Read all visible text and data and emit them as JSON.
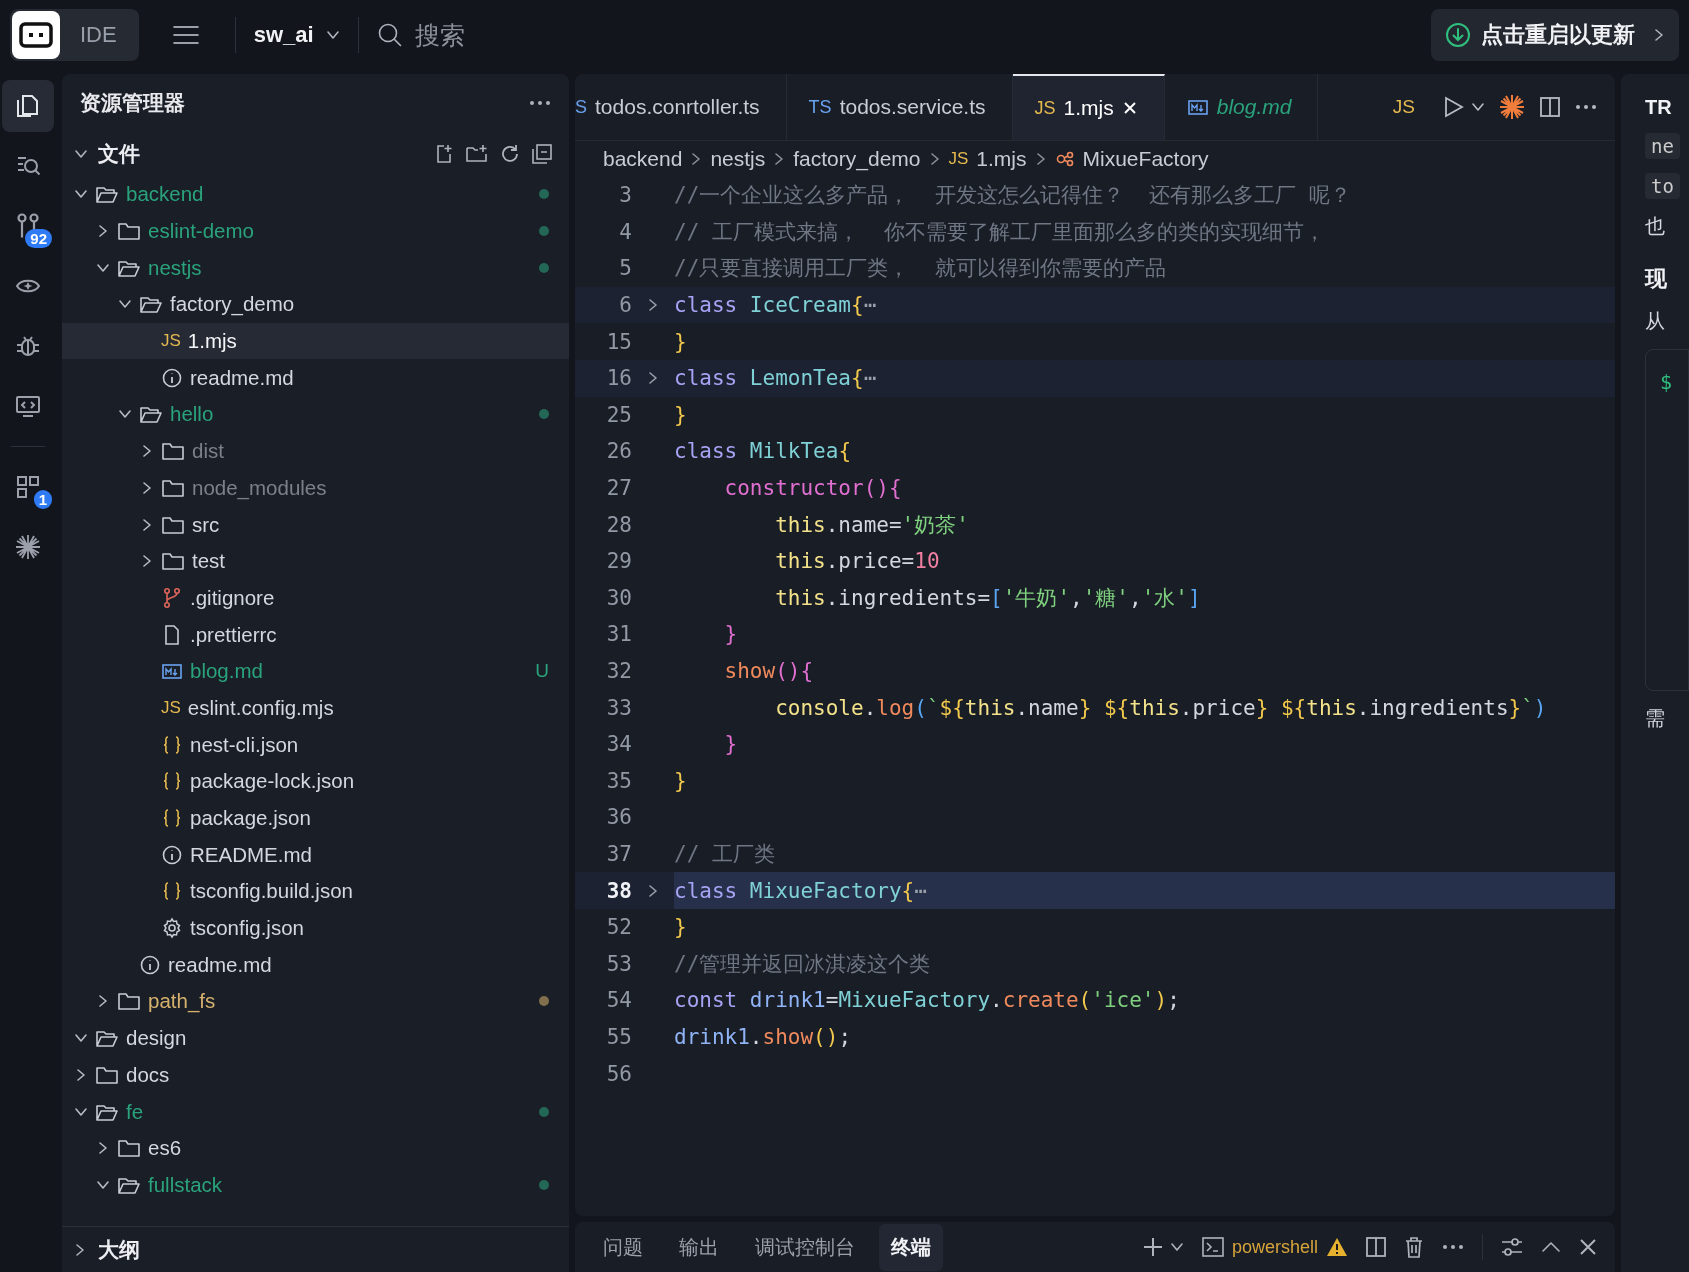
{
  "topbar": {
    "product": "IDE",
    "project": "sw_ai",
    "search": {
      "placeholder": "搜索"
    },
    "update_button": "点击重启以更新"
  },
  "activity_bar": [
    {
      "kind": "files",
      "selected": true
    },
    {
      "kind": "search",
      "selected": false
    },
    {
      "kind": "git",
      "badge": "92",
      "selected": false
    },
    {
      "kind": "eye",
      "selected": false
    },
    {
      "kind": "bug",
      "selected": false
    },
    {
      "kind": "remote",
      "selected": false
    },
    {
      "kind": "extensions",
      "badge": "1",
      "selected": false
    },
    {
      "kind": "sparkle",
      "selected": false
    }
  ],
  "explorer": {
    "title": "资源管理器",
    "section": "文件",
    "tree": [
      {
        "label": "backend",
        "kind": "folder",
        "expanded": true,
        "color": "#2aa37c",
        "dot": true,
        "selected": false,
        "children": [
          {
            "label": "eslint-demo",
            "kind": "folder",
            "expanded": false,
            "color": "#2aa37c",
            "dot": true,
            "selected": false
          },
          {
            "label": "nestjs",
            "kind": "folder",
            "expanded": true,
            "color": "#2aa37c",
            "dot": true,
            "selected": false,
            "children": [
              {
                "label": "factory_demo",
                "kind": "folder",
                "expanded": true,
                "color": "#d4d7de",
                "dot": false,
                "selected": false,
                "children": [
                  {
                    "label": "1.mjs",
                    "kind": "js",
                    "icon": "JS",
                    "color": "#f4f5f7",
                    "selected": true
                  },
                  {
                    "label": "readme.md",
                    "kind": "info",
                    "color": "#d4d7de",
                    "selected": false
                  }
                ]
              },
              {
                "label": "hello",
                "kind": "folder",
                "expanded": true,
                "color": "#2aa37c",
                "dot": true,
                "selected": false,
                "children": [
                  {
                    "label": "dist",
                    "kind": "folder",
                    "expanded": false,
                    "color": "#7b808b",
                    "dot": false,
                    "selected": false
                  },
                  {
                    "label": "node_modules",
                    "kind": "folder",
                    "expanded": false,
                    "color": "#7b808b",
                    "dot": false,
                    "selected": false
                  },
                  {
                    "label": "src",
                    "kind": "folder",
                    "expanded": false,
                    "color": "#d4d7de",
                    "dot": false,
                    "selected": false
                  },
                  {
                    "label": "test",
                    "kind": "folder",
                    "expanded": false,
                    "color": "#d4d7de",
                    "dot": false,
                    "selected": false
                  },
                  {
                    "label": ".gitignore",
                    "kind": "git",
                    "color": "#d4d7de",
                    "selected": false
                  },
                  {
                    "label": ".prettierrc",
                    "kind": "file",
                    "color": "#d4d7de",
                    "selected": false
                  },
                  {
                    "label": "blog.md",
                    "kind": "md",
                    "color": "#2aa37c",
                    "badge": "U",
                    "selected": false
                  },
                  {
                    "label": "eslint.config.mjs",
                    "kind": "js",
                    "icon": "JS",
                    "color": "#d4d7de",
                    "selected": false
                  },
                  {
                    "label": "nest-cli.json",
                    "kind": "json",
                    "color": "#d4d7de",
                    "selected": false
                  },
                  {
                    "label": "package-lock.json",
                    "kind": "json",
                    "color": "#d4d7de",
                    "selected": false
                  },
                  {
                    "label": "package.json",
                    "kind": "json",
                    "color": "#d4d7de",
                    "selected": false
                  },
                  {
                    "label": "README.md",
                    "kind": "info",
                    "color": "#d4d7de",
                    "selected": false
                  },
                  {
                    "label": "tsconfig.build.json",
                    "kind": "json",
                    "color": "#d4d7de",
                    "selected": false
                  },
                  {
                    "label": "tsconfig.json",
                    "kind": "gear",
                    "color": "#d4d7de",
                    "selected": false
                  }
                ]
              },
              {
                "label": "readme.md",
                "kind": "info",
                "color": "#d4d7de",
                "selected": false
              }
            ]
          },
          {
            "label": "path_fs",
            "kind": "folder",
            "expanded": false,
            "color": "#d6b26e",
            "dot": true,
            "selected": false
          }
        ]
      },
      {
        "label": "design",
        "kind": "folder",
        "expanded": true,
        "color": "#d4d7de",
        "dot": false,
        "selected": false
      },
      {
        "label": "docs",
        "kind": "folder",
        "expanded": false,
        "color": "#d4d7de",
        "dot": false,
        "selected": false
      },
      {
        "label": "fe",
        "kind": "folder",
        "expanded": true,
        "color": "#2aa37c",
        "dot": true,
        "selected": false,
        "children": [
          {
            "label": "es6",
            "kind": "folder",
            "expanded": false,
            "color": "#d4d7de",
            "dot": false,
            "selected": false
          },
          {
            "label": "fullstack",
            "kind": "folder",
            "expanded": true,
            "color": "#2aa37c",
            "dot": true,
            "selected": false
          }
        ]
      }
    ],
    "bottom_section": "大纲"
  },
  "editor": {
    "tabs": [
      {
        "kind": "ts",
        "icon": "S",
        "label": "todos.conrtoller.ts",
        "selected": false,
        "preview": false
      },
      {
        "kind": "ts",
        "icon": "TS",
        "label": "todos.service.ts",
        "selected": false,
        "preview": false
      },
      {
        "kind": "js",
        "icon": "JS",
        "label": "1.mjs",
        "selected": true,
        "preview": false
      },
      {
        "kind": "md",
        "label": "blog.md",
        "selected": false,
        "preview": true
      }
    ],
    "toolbar_language": "JS",
    "breadcrumbs": [
      {
        "label": "backend",
        "kind": "folder"
      },
      {
        "label": "nestjs",
        "kind": "folder"
      },
      {
        "label": "factory_demo",
        "kind": "folder"
      },
      {
        "label": "1.mjs",
        "kind": "js",
        "icon": "JS"
      },
      {
        "label": "MixueFactory",
        "kind": "symbol"
      }
    ],
    "lines": [
      {
        "number": "3",
        "folded": false,
        "current": false,
        "tokens": [
          {
            "kind": "cm",
            "t": "//一个企业这么多产品，  开发这怎么记得住？  还有那么多工厂 呢？"
          }
        ]
      },
      {
        "number": "4",
        "folded": false,
        "current": false,
        "tokens": [
          {
            "kind": "cm",
            "t": "// 工厂模式来搞，  你不需要了解工厂里面那么多的类的实现细节，"
          }
        ]
      },
      {
        "number": "5",
        "folded": false,
        "current": false,
        "tokens": [
          {
            "kind": "cm",
            "t": "//只要直接调用工厂类，  就可以得到你需要的产品"
          }
        ]
      },
      {
        "number": "6",
        "folded": true,
        "current": false,
        "tokens": [
          {
            "kind": "kw",
            "t": "class "
          },
          {
            "kind": "cls",
            "t": "IceCream"
          },
          {
            "kind": "brace",
            "t": "{"
          },
          {
            "kind": "fold",
            "t": "⋯"
          }
        ]
      },
      {
        "number": "15",
        "folded": false,
        "current": false,
        "tokens": [
          {
            "kind": "brace",
            "t": "}"
          }
        ]
      },
      {
        "number": "16",
        "folded": true,
        "current": false,
        "tokens": [
          {
            "kind": "kw",
            "t": "class "
          },
          {
            "kind": "cls",
            "t": "LemonTea"
          },
          {
            "kind": "brace",
            "t": "{"
          },
          {
            "kind": "fold",
            "t": "⋯"
          }
        ]
      },
      {
        "number": "25",
        "folded": false,
        "current": false,
        "tokens": [
          {
            "kind": "brace",
            "t": "}"
          }
        ]
      },
      {
        "number": "26",
        "folded": false,
        "current": false,
        "tokens": [
          {
            "kind": "kw",
            "t": "class "
          },
          {
            "kind": "cls",
            "t": "MilkTea"
          },
          {
            "kind": "brace",
            "t": "{"
          }
        ]
      },
      {
        "number": "27",
        "folded": false,
        "current": false,
        "tokens": [
          {
            "kind": "fn2",
            "t": "    constructor"
          },
          {
            "kind": "brace2",
            "t": "(){"
          }
        ]
      },
      {
        "number": "28",
        "folded": false,
        "current": false,
        "tokens": [
          {
            "kind": "this",
            "t": "        this"
          },
          {
            "kind": "punc",
            "t": ".name="
          },
          {
            "kind": "str",
            "t": "'奶茶'"
          }
        ]
      },
      {
        "number": "29",
        "folded": false,
        "current": false,
        "tokens": [
          {
            "kind": "this",
            "t": "        this"
          },
          {
            "kind": "punc",
            "t": ".price="
          },
          {
            "kind": "num",
            "t": "10"
          }
        ]
      },
      {
        "number": "30",
        "folded": false,
        "current": false,
        "tokens": [
          {
            "kind": "this",
            "t": "        this"
          },
          {
            "kind": "punc",
            "t": ".ingredients="
          },
          {
            "kind": "brace3",
            "t": "["
          },
          {
            "kind": "str",
            "t": "'牛奶'"
          },
          {
            "kind": "punc",
            "t": ","
          },
          {
            "kind": "str",
            "t": "'糖'"
          },
          {
            "kind": "punc",
            "t": ","
          },
          {
            "kind": "str",
            "t": "'水'"
          },
          {
            "kind": "brace3",
            "t": "]"
          }
        ]
      },
      {
        "number": "31",
        "folded": false,
        "current": false,
        "tokens": [
          {
            "kind": "brace2",
            "t": "    }"
          }
        ]
      },
      {
        "number": "32",
        "folded": false,
        "current": false,
        "tokens": [
          {
            "kind": "fn",
            "t": "    show"
          },
          {
            "kind": "brace2",
            "t": "(){"
          }
        ]
      },
      {
        "number": "33",
        "folded": false,
        "current": false,
        "tokens": [
          {
            "kind": "this",
            "t": "        console"
          },
          {
            "kind": "punc",
            "t": "."
          },
          {
            "kind": "fn",
            "t": "log"
          },
          {
            "kind": "brace3",
            "t": "("
          },
          {
            "kind": "str",
            "t": "`"
          },
          {
            "kind": "brace",
            "t": "${"
          },
          {
            "kind": "this",
            "t": "this"
          },
          {
            "kind": "punc",
            "t": ".name"
          },
          {
            "kind": "brace",
            "t": "} ${"
          },
          {
            "kind": "this",
            "t": "this"
          },
          {
            "kind": "punc",
            "t": ".price"
          },
          {
            "kind": "brace",
            "t": "} ${"
          },
          {
            "kind": "this",
            "t": "this"
          },
          {
            "kind": "punc",
            "t": ".ingredients"
          },
          {
            "kind": "brace",
            "t": "}"
          },
          {
            "kind": "str",
            "t": "`"
          },
          {
            "kind": "brace3",
            "t": ")"
          }
        ]
      },
      {
        "number": "34",
        "folded": false,
        "current": false,
        "tokens": [
          {
            "kind": "brace2",
            "t": "    }"
          }
        ]
      },
      {
        "number": "35",
        "folded": false,
        "current": false,
        "tokens": [
          {
            "kind": "brace",
            "t": "}"
          }
        ]
      },
      {
        "number": "36",
        "folded": false,
        "current": false
      },
      {
        "number": "37",
        "folded": false,
        "current": false,
        "tokens": [
          {
            "kind": "cm",
            "t": "// 工厂类"
          }
        ]
      },
      {
        "number": "38",
        "folded": true,
        "current": true,
        "tokens": [
          {
            "kind": "kw",
            "t": "class "
          },
          {
            "kind": "cls",
            "t": "MixueFactory"
          },
          {
            "kind": "brace",
            "t": "{"
          },
          {
            "kind": "fold",
            "t": "⋯"
          }
        ]
      },
      {
        "number": "52",
        "folded": false,
        "current": false,
        "tokens": [
          {
            "kind": "brace",
            "t": "}"
          }
        ]
      },
      {
        "number": "53",
        "folded": false,
        "current": false,
        "tokens": [
          {
            "kind": "cm",
            "t": "//管理并返回冰淇凌这个类"
          }
        ]
      },
      {
        "number": "54",
        "folded": false,
        "current": false,
        "tokens": [
          {
            "kind": "kw",
            "t": "const "
          },
          {
            "kind": "var",
            "t": "drink1"
          },
          {
            "kind": "punc",
            "t": "="
          },
          {
            "kind": "cls",
            "t": "MixueFactory"
          },
          {
            "kind": "punc",
            "t": "."
          },
          {
            "kind": "fn",
            "t": "create"
          },
          {
            "kind": "brace",
            "t": "("
          },
          {
            "kind": "str",
            "t": "'ice'"
          },
          {
            "kind": "brace",
            "t": ")"
          },
          {
            "kind": "punc",
            "t": ";"
          }
        ]
      },
      {
        "number": "55",
        "folded": false,
        "current": false,
        "tokens": [
          {
            "kind": "var",
            "t": "drink1"
          },
          {
            "kind": "punc",
            "t": "."
          },
          {
            "kind": "fn",
            "t": "show"
          },
          {
            "kind": "brace",
            "t": "()"
          },
          {
            "kind": "punc",
            "t": ";"
          }
        ]
      },
      {
        "number": "56",
        "folded": false,
        "current": false
      }
    ]
  },
  "panel": {
    "tabs": [
      {
        "label": "问题",
        "selected": false
      },
      {
        "label": "输出",
        "selected": false
      },
      {
        "label": "调试控制台",
        "selected": false
      },
      {
        "label": "终端",
        "selected": true
      }
    ],
    "terminal": "powershell"
  },
  "right_panel": {
    "title": "TR",
    "lines": [
      {
        "kind": "code",
        "text": "ne"
      },
      {
        "kind": "code",
        "text": "to"
      },
      {
        "kind": "text",
        "text": "也"
      },
      {
        "kind": "heading",
        "text": "现"
      },
      {
        "kind": "text",
        "text": "从"
      },
      {
        "kind": "block",
        "text": "$"
      },
      {
        "kind": "text",
        "text": "需"
      }
    ]
  }
}
